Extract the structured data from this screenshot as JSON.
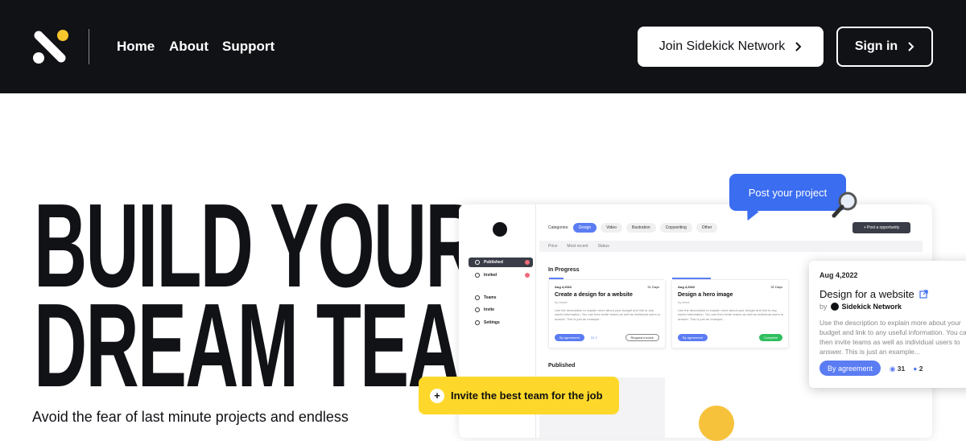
{
  "nav": {
    "links": [
      "Home",
      "About",
      "Support"
    ],
    "join_label": "Join Sidekick Network",
    "signin_label": "Sign in"
  },
  "hero": {
    "line1": "BUILD YOUR",
    "line2": "DREAM TEAM",
    "subtitle": "Avoid the fear of last minute projects and endless"
  },
  "mock": {
    "sidebar": [
      "Published",
      "Invited",
      "Teams",
      "Invite",
      "Settings"
    ],
    "categories_label": "Categories:",
    "categories": [
      "Design",
      "Video",
      "Illustration",
      "Copywriting",
      "Other"
    ],
    "post_opportunity": "+ Post a opportunity",
    "filters": [
      "Price",
      "Most recent",
      "Status"
    ],
    "in_progress": "In Progress",
    "published": "Published",
    "cards": [
      {
        "date": "Aug 4,2022",
        "days": "31 Days",
        "title": "Create a design for a website",
        "by": "by David",
        "desc": "Use the description to explain more about your budget and link to any useful information. You can then invite teams as well as individual users to answer. This is just an example...",
        "btn": "By agreement",
        "stats": "31  2",
        "action": "Request invoice"
      },
      {
        "date": "Aug 4,2022",
        "days": "32 Days",
        "title": "Design a hero image",
        "by": "by Anna",
        "desc": "Use the description to explain more about your budget and link to any useful information. You can then invite teams as well as individual users to answer. This is just an example...",
        "btn": "By agreement",
        "stats": "",
        "action": "Complete"
      }
    ]
  },
  "detail": {
    "date": "Aug 4,2022",
    "title": "Design for a website",
    "by_prefix": "by",
    "by_name": "Sidekick Network",
    "desc": "Use the description to explain more about your budget and link to any useful information. You can then invite teams as well as individual users to answer. This is just an example...",
    "btn": "By agreement",
    "views": "31",
    "comments": "2"
  },
  "bubbles": {
    "post": "Post your project",
    "invite": "Invite the best team for the job"
  },
  "colors": {
    "nav_bg": "#111216",
    "accent_blue": "#3b6df0",
    "accent_yellow": "#fdd82a"
  }
}
